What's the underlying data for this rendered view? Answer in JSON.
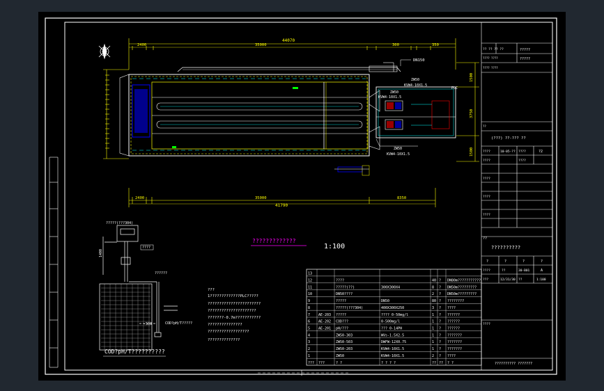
{
  "colors": {
    "frame_bg": "#212830",
    "paper": "#000000",
    "white": "#ffffff",
    "yellow": "#ffff00",
    "cyan": "#00ffff",
    "blue": "#0000ff",
    "magenta": "#ff00ff",
    "red": "#ff0000",
    "green": "#00ff00"
  },
  "dimensions": {
    "top_total": "44070",
    "top_segments": [
      "350",
      "2400",
      "300",
      "35000",
      "350",
      "6070",
      "300",
      "2300",
      "350"
    ],
    "bottom_total": "41790",
    "bottom_segments": [
      "350",
      "2400",
      "300",
      "35000",
      "8350"
    ],
    "right_side": [
      "1500",
      "3750",
      "1500"
    ],
    "left_side": [
      "6150"
    ]
  },
  "plan": {
    "pipe_label": "DN150",
    "pump_top": "ZW50",
    "pump_top_spec": "KVW4-10X1.5",
    "pump_mid": "ZW50",
    "pump_mid_spec": "KVW4-10X1.5",
    "pump_bottom": "ZW50",
    "pump_bottom_spec": "KVW4-10X1.5",
    "box_label": "PLC",
    "title_magenta": "?????????????",
    "scale": "1:100"
  },
  "detail": {
    "controller_label": "?????(???304)",
    "instrument_label": "????",
    "sensor_label": "??????",
    "elev_label": "1400",
    "level_label": "-500",
    "probe_label": "COD?pH/T?????",
    "caption": "COD?pH/T??????????"
  },
  "notes": {
    "heading": "???",
    "lines": [
      "1?????????????PLC?????",
      "  ???????????????????????",
      "  ?????????????????????",
      "  ???????-0.7m???????????",
      "  ???????????????",
      "  ??????????????????",
      "  ??????????????"
    ]
  },
  "table": {
    "rows": [
      [
        "13",
        "",
        "",
        "",
        "",
        "",
        ""
      ],
      [
        "12",
        "",
        "????",
        "",
        "40",
        "?",
        "DN80m???????????"
      ],
      [
        "11",
        "",
        "?????(??)",
        "300X300X4",
        "8",
        "?",
        "DN50m?????????"
      ],
      [
        "10",
        "",
        "DN50????",
        "",
        "2",
        "?",
        "DN50m?????????"
      ],
      [
        "9",
        "",
        "?????",
        "DN50",
        "80",
        "?",
        "????????"
      ],
      [
        "8",
        "",
        "?????(???304)",
        "400X300X250",
        "3",
        "?",
        "????"
      ],
      [
        "7",
        "AE-203",
        "?????",
        "???? 0-50mg/l",
        "1",
        "?",
        "??????"
      ],
      [
        "6",
        "AE-202",
        "COD???",
        "0-500mg/l",
        "1",
        "?",
        "??????"
      ],
      [
        "5",
        "AE-201",
        "pH/???",
        "??? 0-14PH",
        "1",
        "?",
        "??????"
      ],
      [
        "4",
        "",
        "ZW50-303",
        "WVs-1.5X2.5",
        "1",
        "?",
        "???????"
      ],
      [
        "3",
        "",
        "ZW50-503",
        "DWFW-12X0.75",
        "1",
        "?",
        "???????"
      ],
      [
        "2",
        "",
        "ZW50-203",
        "KVW4-10X1.5",
        "1",
        "?",
        "???????"
      ],
      [
        "1",
        "",
        "ZW50",
        "KVW4-10X1.5",
        "2",
        "?",
        "????"
      ],
      [
        "???",
        "???",
        "? ?",
        "? ? ? ?",
        "??",
        "??",
        "? ?"
      ]
    ]
  },
  "title_block": {
    "r1_a": "?? ?? ?? ??",
    "r1_b": "?????",
    "r1_c": "?????",
    "r2": "???? ????",
    "r3": "???? ????",
    "r4_a": "??",
    "r4_b": "????",
    "drawing_name": "(???) ??-??? ??",
    "row_a": [
      "????",
      "10-05-??",
      "????",
      "?2"
    ],
    "row_b": [
      "????",
      "",
      "????",
      ""
    ],
    "row_c": [
      "????",
      "",
      "",
      ""
    ],
    "row_d": [
      "????",
      "",
      "",
      ""
    ],
    "row_e": [
      "????",
      "",
      "",
      ""
    ],
    "project_label": "??",
    "project_name": "??????????",
    "sheet_row1": [
      "?",
      "?",
      "?",
      "?"
    ],
    "sheet_row2": [
      "????",
      "??",
      "30-B01",
      "A"
    ],
    "sheet_row3": [
      "???",
      "12/31/30",
      "??",
      "1:100"
    ],
    "owner_label": "????",
    "company": "?????????? ???????"
  }
}
